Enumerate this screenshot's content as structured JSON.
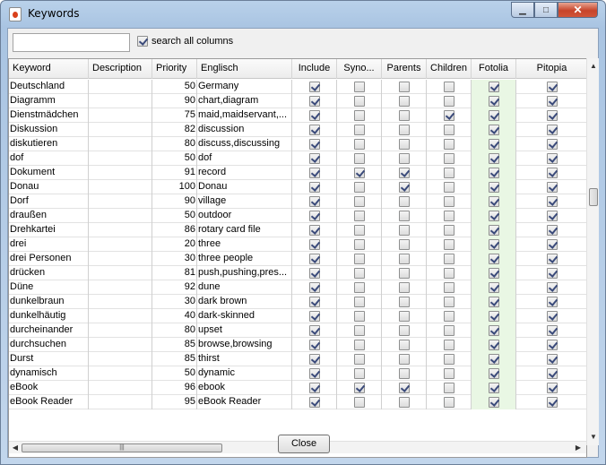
{
  "window": {
    "title": "Keywords",
    "caption": {
      "minimize": "▁",
      "maximize": "□",
      "close": "✕"
    }
  },
  "search": {
    "value": "",
    "placeholder": "",
    "all_columns_label": "search all columns",
    "all_columns_checked": true
  },
  "columns": [
    "Keyword",
    "Description",
    "Priority",
    "Englisch",
    "Include",
    "Syno...",
    "Parents",
    "Children",
    "Fotolia",
    "Pitopia"
  ],
  "rows": [
    {
      "keyword": "Deutschland",
      "description": "",
      "priority": "50",
      "englisch": "Germany",
      "include": true,
      "syno": false,
      "parents": false,
      "children": false,
      "fotolia": true,
      "pitopia": true
    },
    {
      "keyword": "Diagramm",
      "description": "",
      "priority": "90",
      "englisch": "chart,diagram",
      "include": true,
      "syno": false,
      "parents": false,
      "children": false,
      "fotolia": true,
      "pitopia": true
    },
    {
      "keyword": "Dienstmädchen",
      "description": "",
      "priority": "75",
      "englisch": "maid,maidservant,...",
      "include": true,
      "syno": false,
      "parents": false,
      "children": true,
      "fotolia": true,
      "pitopia": true
    },
    {
      "keyword": "Diskussion",
      "description": "",
      "priority": "82",
      "englisch": "discussion",
      "include": true,
      "syno": false,
      "parents": false,
      "children": false,
      "fotolia": true,
      "pitopia": true
    },
    {
      "keyword": "diskutieren",
      "description": "",
      "priority": "80",
      "englisch": "discuss,discussing",
      "include": true,
      "syno": false,
      "parents": false,
      "children": false,
      "fotolia": true,
      "pitopia": true
    },
    {
      "keyword": "dof",
      "description": "",
      "priority": "50",
      "englisch": "dof",
      "include": true,
      "syno": false,
      "parents": false,
      "children": false,
      "fotolia": true,
      "pitopia": true
    },
    {
      "keyword": "Dokument",
      "description": "",
      "priority": "91",
      "englisch": "record",
      "include": true,
      "syno": true,
      "parents": true,
      "children": false,
      "fotolia": true,
      "pitopia": true
    },
    {
      "keyword": "Donau",
      "description": "",
      "priority": "100",
      "englisch": "Donau",
      "include": true,
      "syno": false,
      "parents": true,
      "children": false,
      "fotolia": true,
      "pitopia": true
    },
    {
      "keyword": "Dorf",
      "description": "",
      "priority": "90",
      "englisch": "village",
      "include": true,
      "syno": false,
      "parents": false,
      "children": false,
      "fotolia": true,
      "pitopia": true
    },
    {
      "keyword": "draußen",
      "description": "",
      "priority": "50",
      "englisch": "outdoor",
      "include": true,
      "syno": false,
      "parents": false,
      "children": false,
      "fotolia": true,
      "pitopia": true
    },
    {
      "keyword": "Drehkartei",
      "description": "",
      "priority": "86",
      "englisch": "rotary card file",
      "include": true,
      "syno": false,
      "parents": false,
      "children": false,
      "fotolia": true,
      "pitopia": true
    },
    {
      "keyword": "drei",
      "description": "",
      "priority": "20",
      "englisch": "three",
      "include": true,
      "syno": false,
      "parents": false,
      "children": false,
      "fotolia": true,
      "pitopia": true
    },
    {
      "keyword": "drei Personen",
      "description": "",
      "priority": "30",
      "englisch": "three people",
      "include": true,
      "syno": false,
      "parents": false,
      "children": false,
      "fotolia": true,
      "pitopia": true
    },
    {
      "keyword": "drücken",
      "description": "",
      "priority": "81",
      "englisch": "push,pushing,pres...",
      "include": true,
      "syno": false,
      "parents": false,
      "children": false,
      "fotolia": true,
      "pitopia": true
    },
    {
      "keyword": "Düne",
      "description": "",
      "priority": "92",
      "englisch": "dune",
      "include": true,
      "syno": false,
      "parents": false,
      "children": false,
      "fotolia": true,
      "pitopia": true
    },
    {
      "keyword": "dunkelbraun",
      "description": "",
      "priority": "30",
      "englisch": "dark brown",
      "include": true,
      "syno": false,
      "parents": false,
      "children": false,
      "fotolia": true,
      "pitopia": true
    },
    {
      "keyword": "dunkelhäutig",
      "description": "",
      "priority": "40",
      "englisch": "dark-skinned",
      "include": true,
      "syno": false,
      "parents": false,
      "children": false,
      "fotolia": true,
      "pitopia": true
    },
    {
      "keyword": "durcheinander",
      "description": "",
      "priority": "80",
      "englisch": "upset",
      "include": true,
      "syno": false,
      "parents": false,
      "children": false,
      "fotolia": true,
      "pitopia": true
    },
    {
      "keyword": "durchsuchen",
      "description": "",
      "priority": "85",
      "englisch": "browse,browsing",
      "include": true,
      "syno": false,
      "parents": false,
      "children": false,
      "fotolia": true,
      "pitopia": true
    },
    {
      "keyword": "Durst",
      "description": "",
      "priority": "85",
      "englisch": "thirst",
      "include": true,
      "syno": false,
      "parents": false,
      "children": false,
      "fotolia": true,
      "pitopia": true
    },
    {
      "keyword": "dynamisch",
      "description": "",
      "priority": "50",
      "englisch": "dynamic",
      "include": true,
      "syno": false,
      "parents": false,
      "children": false,
      "fotolia": true,
      "pitopia": true
    },
    {
      "keyword": "eBook",
      "description": "",
      "priority": "96",
      "englisch": "ebook",
      "include": true,
      "syno": true,
      "parents": true,
      "children": false,
      "fotolia": true,
      "pitopia": true
    },
    {
      "keyword": "eBook Reader",
      "description": "",
      "priority": "95",
      "englisch": "eBook Reader",
      "include": true,
      "syno": false,
      "parents": false,
      "children": false,
      "fotolia": true,
      "pitopia": true
    }
  ],
  "scroll": {
    "up": "▲",
    "down": "▼",
    "left": "◀",
    "right": "▶",
    "grip": "|||"
  },
  "buttons": {
    "close": "Close"
  },
  "colors": {
    "fotolia_bg": "#e9f7e4"
  }
}
